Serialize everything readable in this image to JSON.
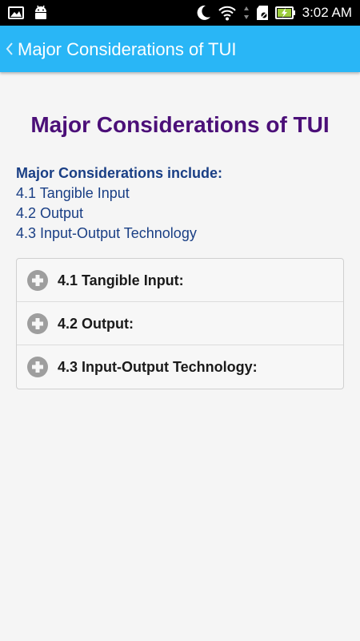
{
  "status_bar": {
    "time": "3:02 AM",
    "icons": [
      "gallery-icon",
      "android-icon",
      "moon-icon",
      "wifi-icon",
      "data-arrows-icon",
      "sd-card-icon",
      "battery-charging-icon"
    ]
  },
  "app_bar": {
    "title": "Major Considerations of TUI",
    "back_icon": "chevron-left-icon"
  },
  "page": {
    "title": "Major Considerations of TUI",
    "intro_heading": "Major Considerations include:",
    "intro_items": [
      "4.1 Tangible Input",
      "4.2 Output",
      "4.3 Input-Output Technology"
    ]
  },
  "accordion": {
    "items": [
      {
        "label": "4.1 Tangible Input:",
        "icon": "plus-circle-icon"
      },
      {
        "label": "4.2 Output:",
        "icon": "plus-circle-icon"
      },
      {
        "label": "4.3 Input-Output Technology:",
        "icon": "plus-circle-icon"
      }
    ]
  },
  "colors": {
    "app_bar": "#29b6f6",
    "title": "#4b0f78",
    "intro": "#1a3f85",
    "icon": "#9e9e9e"
  }
}
